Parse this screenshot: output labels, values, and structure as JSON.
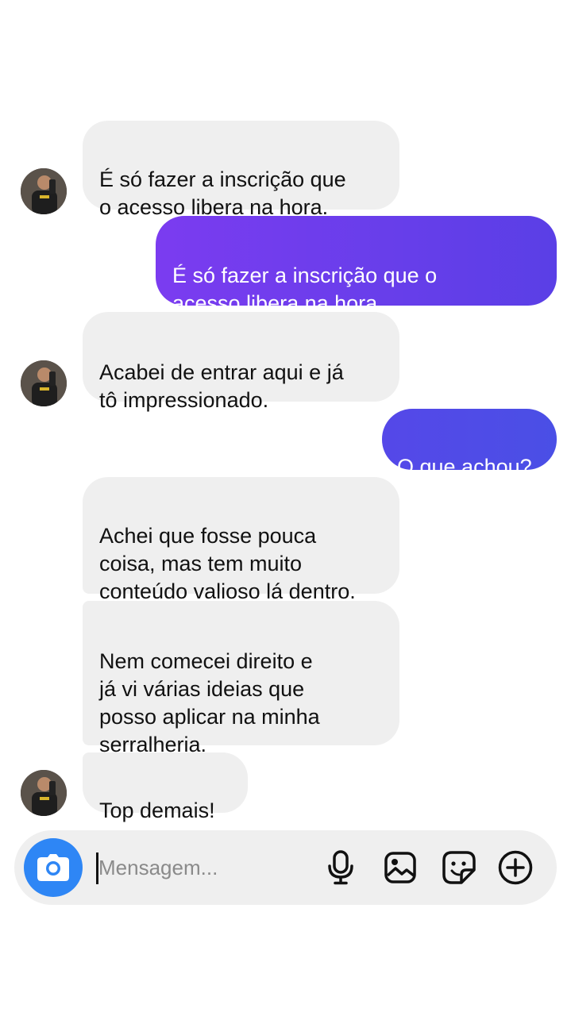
{
  "conversation": {
    "messages": [
      {
        "sender": "other",
        "text": "É só fazer a inscrição que\no acesso libera na hora."
      },
      {
        "sender": "me",
        "text": "É só fazer a inscrição que o\nacesso libera na hora."
      },
      {
        "sender": "other",
        "text": "Acabei de entrar aqui e já\ntô impressionado."
      },
      {
        "sender": "me",
        "text": "O que achou?"
      },
      {
        "sender": "other",
        "text": "Achei que fosse pouca\ncoisa, mas tem muito\nconteúdo valioso lá dentro."
      },
      {
        "sender": "other",
        "text": "Nem comecei direito e\njá vi várias ideias que\nposso aplicar na minha\nserralheria."
      },
      {
        "sender": "other",
        "text": "Top demais!"
      }
    ]
  },
  "composer": {
    "placeholder": "Mensagem...",
    "value": "",
    "icons": [
      "camera-icon",
      "microphone-icon",
      "image-icon",
      "sticker-icon",
      "plus-icon"
    ]
  },
  "colors": {
    "incoming_bubble": "#efefef",
    "outgoing_gradient_start": "#7b3cf0",
    "outgoing_gradient_end": "#5a3fe6",
    "camera_button": "#2e86f5"
  }
}
